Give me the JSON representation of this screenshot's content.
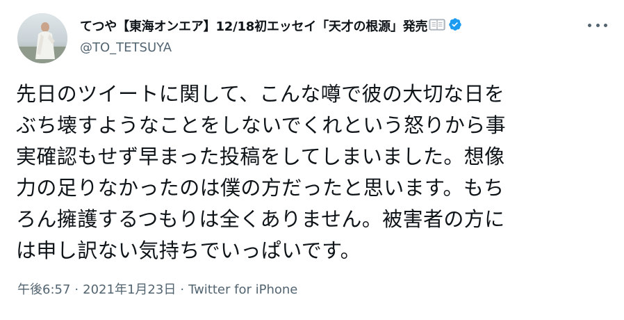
{
  "tweet": {
    "display_name": "てつや【東海オンエア】12/18初エッセイ「天才の根源」発売",
    "book_icon": "open-book-icon",
    "verified_icon": "verified-badge-icon",
    "handle": "@TO_TETSUYA",
    "more_icon": "more-options-icon",
    "body_lines": [
      "先日のツイートに関して、こんな噂で彼の大切な日を",
      "ぶち壊すようなことをしないでくれという怒りから事",
      "実確認もせず早まった投稿をしてしまいました。想像",
      "力の足りなかったのは僕の方だったと思います。もち",
      "ろん擁護するつもりは全くありません。被害者の方に",
      "は申し訳ない気持ちでいっぱいです。"
    ],
    "time": "午後6:57",
    "separator": "·",
    "date": "2021年1月23日",
    "source": "Twitter for iPhone"
  },
  "colors": {
    "text": "#0f1419",
    "secondary": "#536471",
    "verified": "#1d9bf0"
  }
}
